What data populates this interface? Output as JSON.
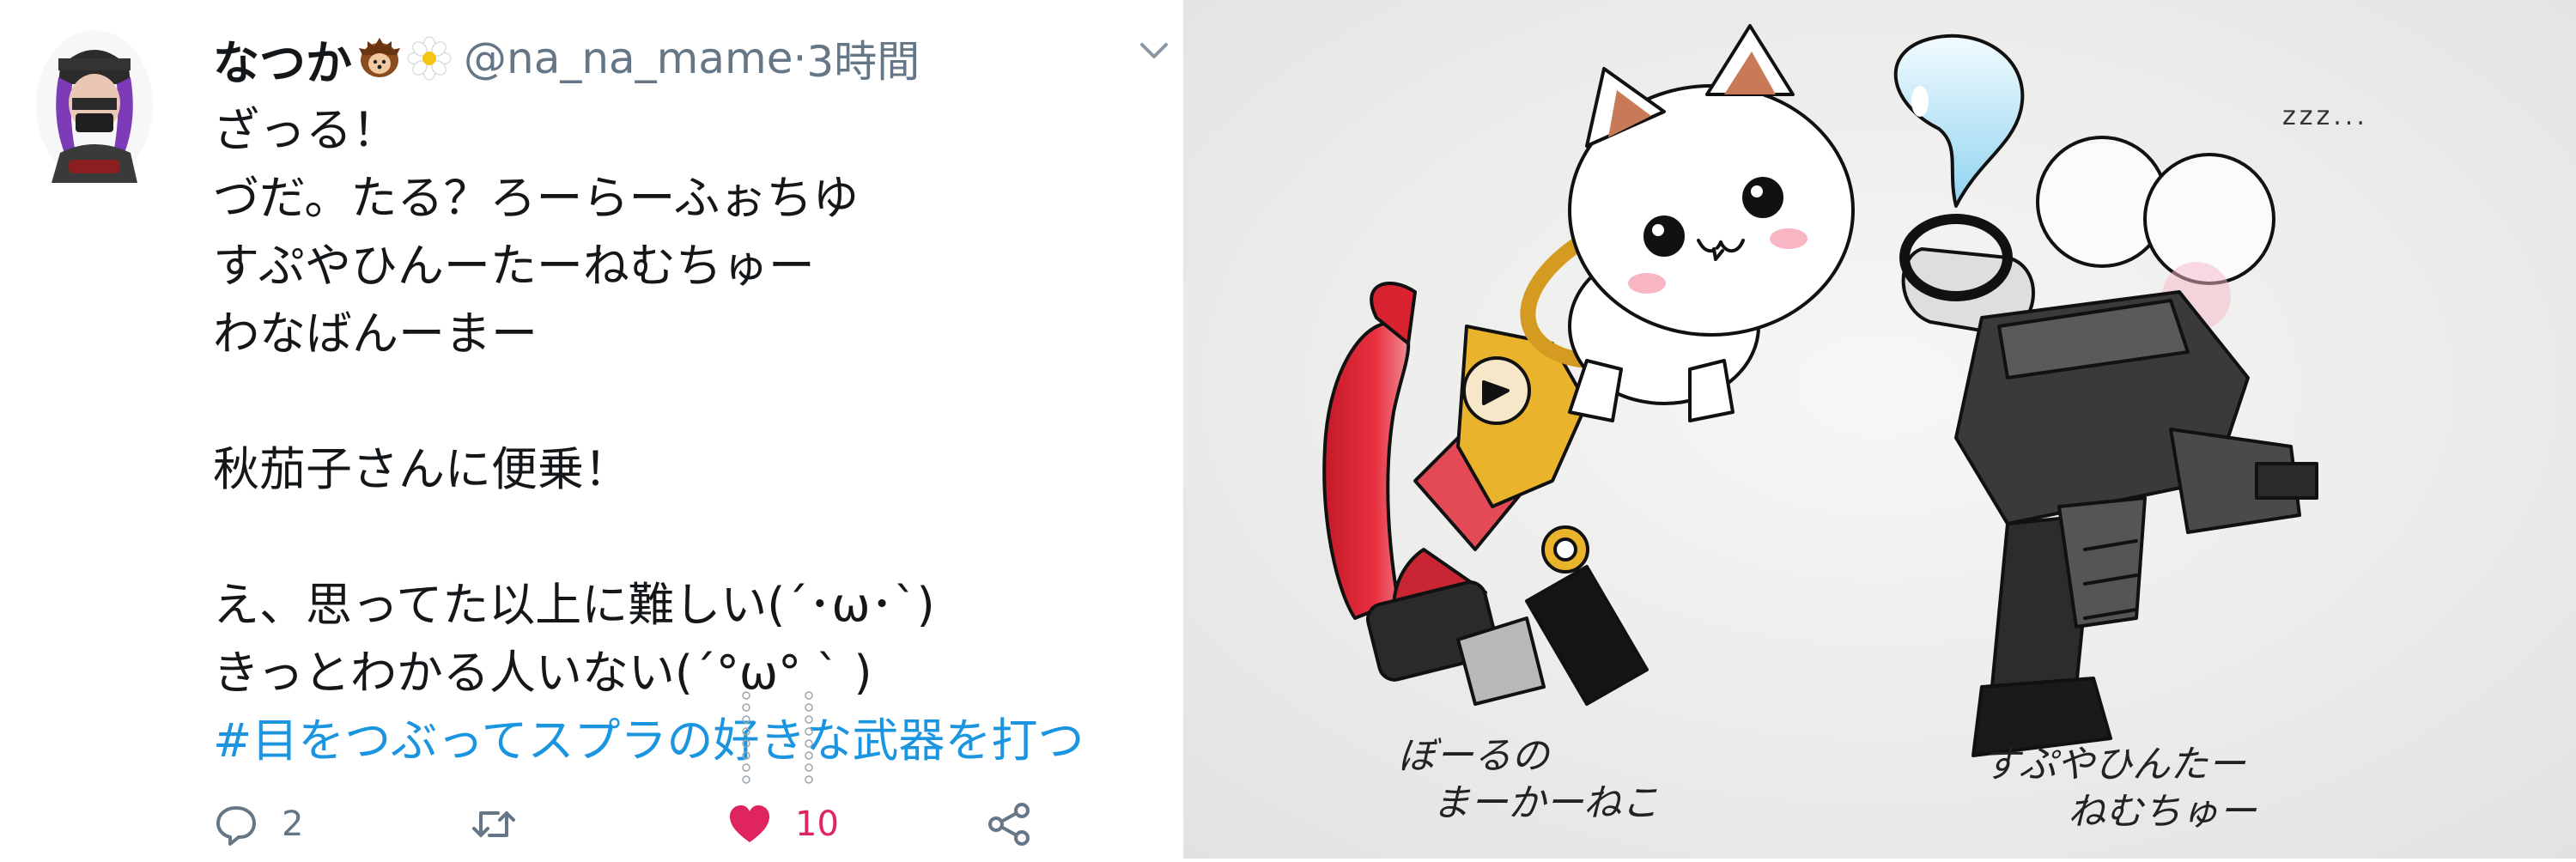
{
  "tweet": {
    "display_name": "なつか",
    "handle": "@na_na_mame",
    "separator": " · ",
    "time": "3時間",
    "lines": [
      "ざっる！",
      "づだ。たる？ろーらーふぉちゆ",
      "すぷやひんーたーねむちゅー",
      "わなばんーまー",
      "",
      "秋茄子さんに便乗！",
      "",
      "え、思ってた以上に難しい(´･ω･`)",
      "きっとわかる人いない(´°ω° ` )"
    ],
    "hashtag": "#目をつぶってスプラの好きな武器を打つ",
    "actions": {
      "reply_count": "2",
      "retweet_count": "",
      "like_count": "10"
    },
    "icons": {
      "emoji_1": "hedgehog-icon",
      "emoji_2": "flower-icon",
      "caret": "chevron-down-icon",
      "reply": "reply-icon",
      "retweet": "retweet-icon",
      "like": "heart-icon",
      "share": "share-icon"
    },
    "colors": {
      "text": "#14171a",
      "secondary": "#657786",
      "link": "#1b95e0",
      "like": "#e0245e"
    }
  },
  "drawing": {
    "zzz": "zzz...",
    "caption_left_line1": "ぼーるの",
    "caption_left_line2": "まーかーねこ",
    "caption_right_line1": "すぷやひんたー",
    "caption_right_line2": "ねむちゅー"
  }
}
